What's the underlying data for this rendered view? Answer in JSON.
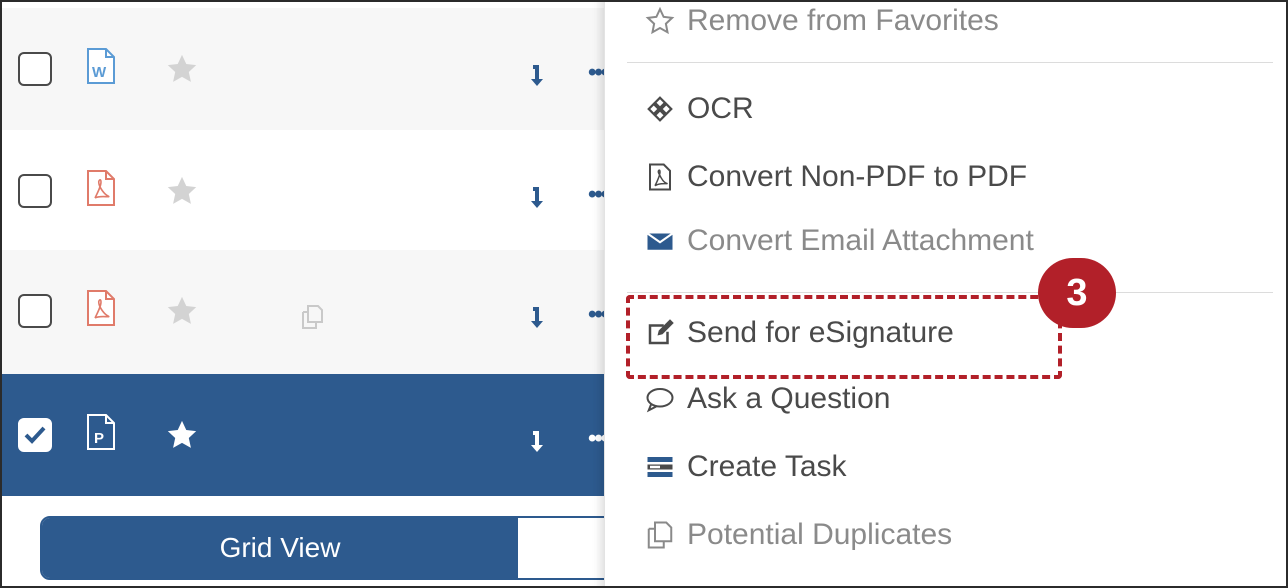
{
  "rows": [
    {
      "file_type": "word",
      "starred": false,
      "selected": false,
      "has_duplicate": false
    },
    {
      "file_type": "pdf",
      "starred": false,
      "selected": false,
      "has_duplicate": false
    },
    {
      "file_type": "pdf",
      "starred": false,
      "selected": false,
      "has_duplicate": true
    },
    {
      "file_type": "publisher",
      "starred": true,
      "selected": true,
      "has_duplicate": false
    }
  ],
  "row_actions": {
    "more_label": "•••"
  },
  "view_toggle": {
    "active_label": "Grid View"
  },
  "context_menu": {
    "items": [
      {
        "label": "Remove from Favorites",
        "icon": "star-outline-icon"
      },
      {
        "label": "OCR",
        "icon": "crosshair-icon"
      },
      {
        "label": "Convert Non-PDF to PDF",
        "icon": "pdf-file-icon"
      },
      {
        "label": "Convert Email Attachment",
        "icon": "envelope-icon"
      },
      {
        "label": "Send for eSignature",
        "icon": "edit-icon"
      },
      {
        "label": "Ask a Question",
        "icon": "speech-bubble-icon"
      },
      {
        "label": "Create Task",
        "icon": "task-icon"
      },
      {
        "label": "Potential Duplicates",
        "icon": "duplicates-icon"
      }
    ]
  },
  "annotation": {
    "step_number": "3"
  },
  "colors": {
    "accent": "#2d5a8e",
    "highlight": "#b22029"
  }
}
